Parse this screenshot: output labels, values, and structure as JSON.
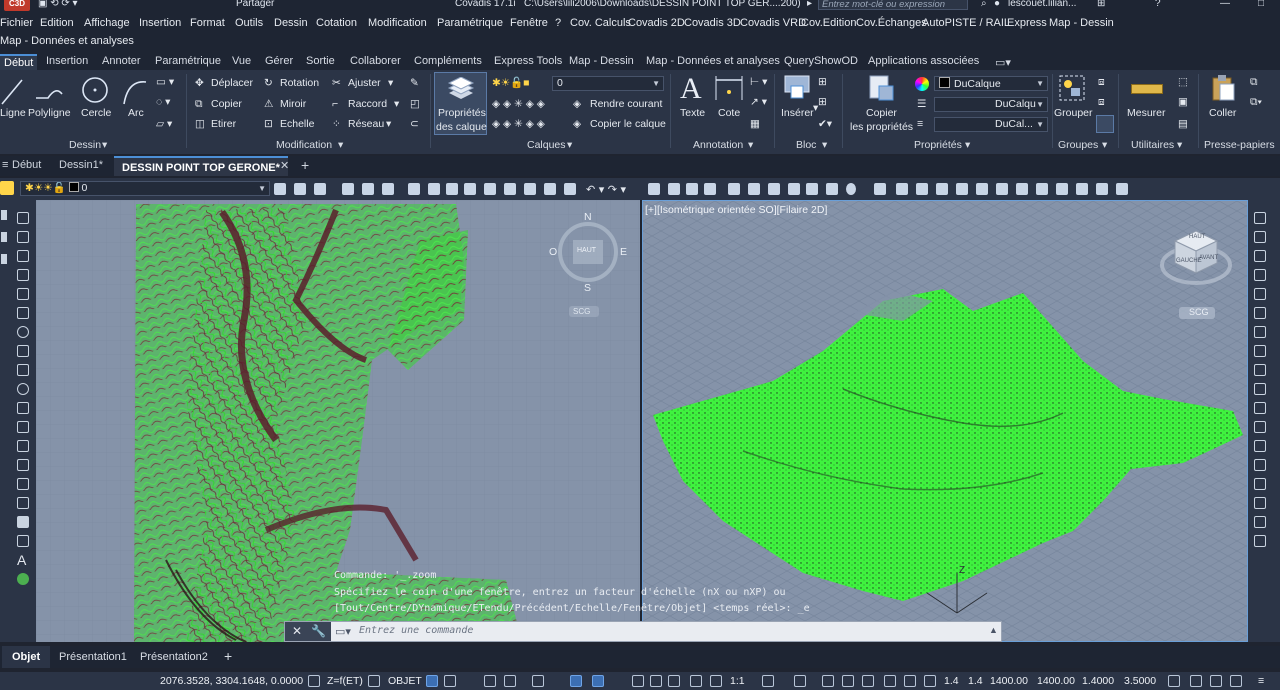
{
  "titlebar": {
    "share": "Partager",
    "app_title": "Covadis 17.1i",
    "file_path": "C:\\Users\\lili2006\\Downloads\\DESSIN POINT TOP GER....200)",
    "search_placeholder": "Entrez mot-clé ou expression",
    "user": "lescouet.lilian..."
  },
  "menu": {
    "row1": [
      "Fichier",
      "Edition",
      "Affichage",
      "Insertion",
      "Format",
      "Outils",
      "Dessin",
      "Cotation",
      "Modification",
      "Paramétrique",
      "Fenêtre",
      "?",
      "Cov. Calculs",
      "Covadis 2D",
      "Covadis 3D",
      "Covadis VRD",
      "Cov.Edition",
      "Cov.Échanges",
      "AutoPISTE / RAIL",
      "Express",
      "Map - Dessin"
    ],
    "row2": [
      "Map - Données et analyses"
    ]
  },
  "ribbon_tabs": [
    "Début",
    "Insertion",
    "Annoter",
    "Paramétrique",
    "Vue",
    "Gérer",
    "Sortie",
    "Collaborer",
    "Compléments",
    "Express Tools",
    "Map - Dessin",
    "Map - Données et analyses",
    "QueryShowOD",
    "Applications associées"
  ],
  "ribbon": {
    "dessin": {
      "title": "Dessin",
      "tools": [
        "Ligne",
        "Polyligne",
        "Cercle",
        "Arc"
      ]
    },
    "modification": {
      "title": "Modification",
      "tools": [
        "Déplacer",
        "Rotation",
        "Ajuster",
        "Copier",
        "Miroir",
        "Raccord",
        "Etirer",
        "Echelle",
        "Réseau"
      ]
    },
    "calques": {
      "title": "Calques",
      "props_line1": "Propriétés",
      "props_line2": "des calque",
      "layer": "0",
      "make_current": "Rendre courant",
      "copy_layer": "Copier le calque"
    },
    "annotation": {
      "title": "Annotation",
      "tools": [
        "Texte",
        "Cote"
      ]
    },
    "bloc": {
      "title": "Bloc",
      "tools": [
        "Insérer"
      ]
    },
    "proprietes": {
      "title": "Propriétés",
      "copy_line1": "Copier",
      "copy_line2": "les propriétés",
      "color": "DuCalque",
      "linetype": "DuCalqu",
      "lineweight": "DuCal..."
    },
    "groupes": {
      "title": "Groupes",
      "tools": [
        "Grouper"
      ]
    },
    "utilitaires": {
      "title": "Utilitaires",
      "tools": [
        "Mesurer"
      ]
    },
    "presse_papiers": {
      "title": "Presse-papiers",
      "tools": [
        "Coller"
      ]
    }
  },
  "doc_tabs": [
    "Début",
    "Dessin1*",
    "DESSIN POINT TOP GERONE*",
    "+"
  ],
  "toolbar": {
    "layer": "0"
  },
  "viewports": {
    "left": {
      "compass": {
        "n": "N",
        "s": "S",
        "e": "E",
        "o": "O"
      },
      "top": "HAUT",
      "ucs": "SCG"
    },
    "right": {
      "label": "[+][Isométrique orientée SO][Filaire 2D]",
      "ucs": "SCG",
      "cube_face": "HAUT",
      "cube_front": "AVANT",
      "cube_left": "GAUCHE",
      "axis_z": "Z"
    }
  },
  "command": {
    "history": [
      "Commande: '_.zoom",
      "Spécifiez le coin d'une fenêtre, entrez un facteur d'échelle (nX ou nXP) ou",
      "[Tout/Centre/DYnamique/ETendu/Précédent/Echelle/Fenêtre/Objet] <temps réel>: _e"
    ],
    "placeholder": "Entrez une commande"
  },
  "layout_tabs": [
    "Objet",
    "Présentation1",
    "Présentation2",
    "+"
  ],
  "status": {
    "coords": "2076.3528, 3304.1648, 0.0000",
    "zmode": "Z=f(ET)",
    "object": "OBJET",
    "scale": "1:1",
    "v1": "1.4",
    "v2": "1.4",
    "v3": "1400.00",
    "v4": "1400.00",
    "v5": "1.4000",
    "v6": "3.5000"
  },
  "colors": {
    "accent": "#4c8fd6",
    "terrain": "#33e633",
    "contour": "#7a2a3a",
    "viewport_bg": "#8593a9"
  }
}
